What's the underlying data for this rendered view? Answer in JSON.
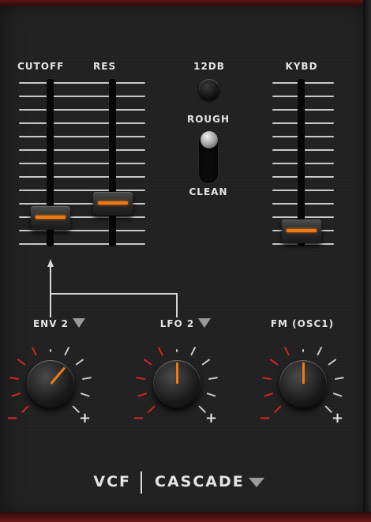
{
  "sliders": {
    "cutoff": {
      "label": "CUTOFF",
      "level": 0.1
    },
    "res": {
      "label": "RES",
      "level": 0.2
    },
    "kybd": {
      "label": "KYBD",
      "level": 0.0
    }
  },
  "switches": {
    "db12": {
      "label": "12DB"
    },
    "rough_clean": {
      "top_label": "ROUGH",
      "bottom_label": "CLEAN",
      "position": "ROUGH"
    }
  },
  "modulation": {
    "env2": {
      "label": "ENV 2",
      "value_percent": 65
    },
    "lfo2": {
      "label": "LFO 2",
      "value_percent": 50
    },
    "fm": {
      "label": "FM (OSC1)",
      "value_percent": 50
    },
    "minus": "−",
    "plus": "+"
  },
  "footer": {
    "section": "VCF",
    "mode": "CASCADE"
  },
  "colors": {
    "accent": "#f07a12",
    "negative_tick": "#d62424",
    "tick": "#c9c9c9",
    "panel": "#232324",
    "frame": "#5a1414"
  }
}
